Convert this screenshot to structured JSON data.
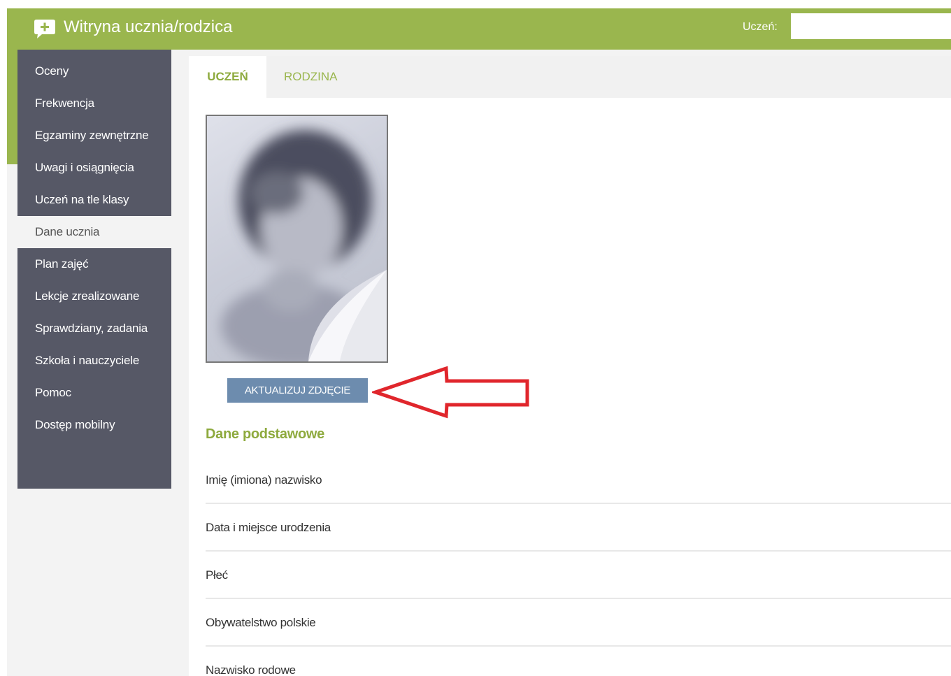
{
  "header": {
    "app_title": "Witryna ucznia/rodzica",
    "student_label": "Uczeń:",
    "student_value": "",
    "accent_color": "#9ab64e"
  },
  "sidebar": {
    "items": [
      {
        "label": "Oceny",
        "active": false
      },
      {
        "label": "Frekwencja",
        "active": false
      },
      {
        "label": "Egzaminy zewnętrzne",
        "active": false
      },
      {
        "label": "Uwagi i osiągnięcia",
        "active": false
      },
      {
        "label": "Uczeń na tle klasy",
        "active": false
      },
      {
        "label": "Dane ucznia",
        "active": true
      },
      {
        "label": "Plan zajęć",
        "active": false
      },
      {
        "label": "Lekcje zrealizowane",
        "active": false
      },
      {
        "label": "Sprawdziany, zadania",
        "active": false
      },
      {
        "label": "Szkoła i nauczyciele",
        "active": false
      },
      {
        "label": "Pomoc",
        "active": false
      },
      {
        "label": "Dostęp mobilny",
        "active": false
      }
    ],
    "bg_color": "#565866"
  },
  "tabs": [
    {
      "label": "UCZEŃ",
      "active": true
    },
    {
      "label": "RODZINA",
      "active": false
    }
  ],
  "photo": {
    "icon": "student-photo",
    "button_label": "AKTUALIZUJ ZDJĘCIE",
    "button_color": "#6d8cae"
  },
  "annotation": {
    "icon": "arrow-left-icon",
    "color": "#e0262c"
  },
  "basic_data": {
    "title": "Dane podstawowe",
    "fields": [
      {
        "label": "Imię (imiona) nazwisko"
      },
      {
        "label": "Data i miejsce urodzenia"
      },
      {
        "label": "Płeć"
      },
      {
        "label": "Obywatelstwo polskie"
      },
      {
        "label": "Nazwisko rodowe"
      }
    ]
  }
}
